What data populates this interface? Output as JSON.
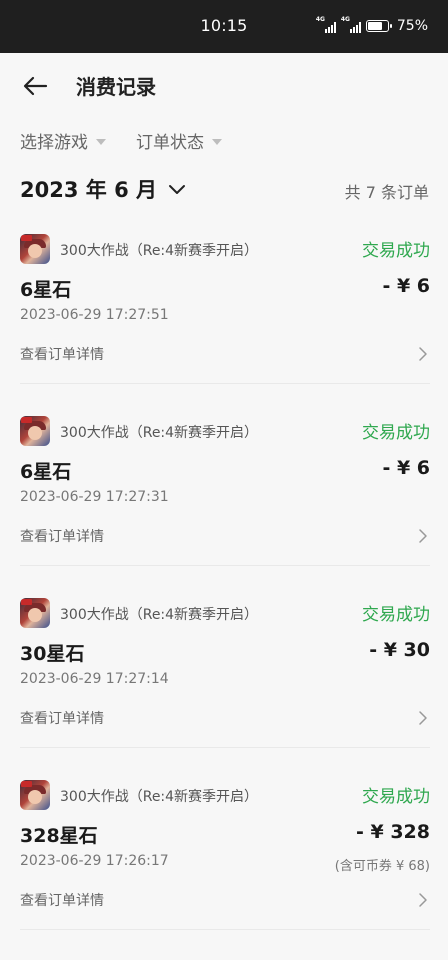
{
  "status_bar": {
    "time": "10:15",
    "signal1_label": "4G",
    "signal2_label": "4G",
    "battery_percent": "75%",
    "battery_level": 0.75
  },
  "header": {
    "title": "消费记录"
  },
  "filters": {
    "game": "选择游戏",
    "order_status": "订单状态"
  },
  "month": {
    "label": "2023 年 6 月",
    "order_count": "共 7 条订单"
  },
  "colors": {
    "success": "#2fa84f",
    "status_bar_bg": "#1f1f1f",
    "page_bg": "#f7f7f7"
  },
  "orders": [
    {
      "game": "300大作战（Re:4新赛季开启）",
      "status": "交易成功",
      "item": "6星石",
      "amount": "- ¥ 6",
      "time": "2023-06-29 17:27:51",
      "note": "",
      "details": "查看订单详情"
    },
    {
      "game": "300大作战（Re:4新赛季开启）",
      "status": "交易成功",
      "item": "6星石",
      "amount": "- ¥ 6",
      "time": "2023-06-29 17:27:31",
      "note": "",
      "details": "查看订单详情"
    },
    {
      "game": "300大作战（Re:4新赛季开启）",
      "status": "交易成功",
      "item": "30星石",
      "amount": "- ¥ 30",
      "time": "2023-06-29 17:27:14",
      "note": "",
      "details": "查看订单详情"
    },
    {
      "game": "300大作战（Re:4新赛季开启）",
      "status": "交易成功",
      "item": "328星石",
      "amount": "- ¥ 328",
      "time": "2023-06-29 17:26:17",
      "note": "(含可币券 ¥ 68)",
      "details": "查看订单详情"
    }
  ]
}
